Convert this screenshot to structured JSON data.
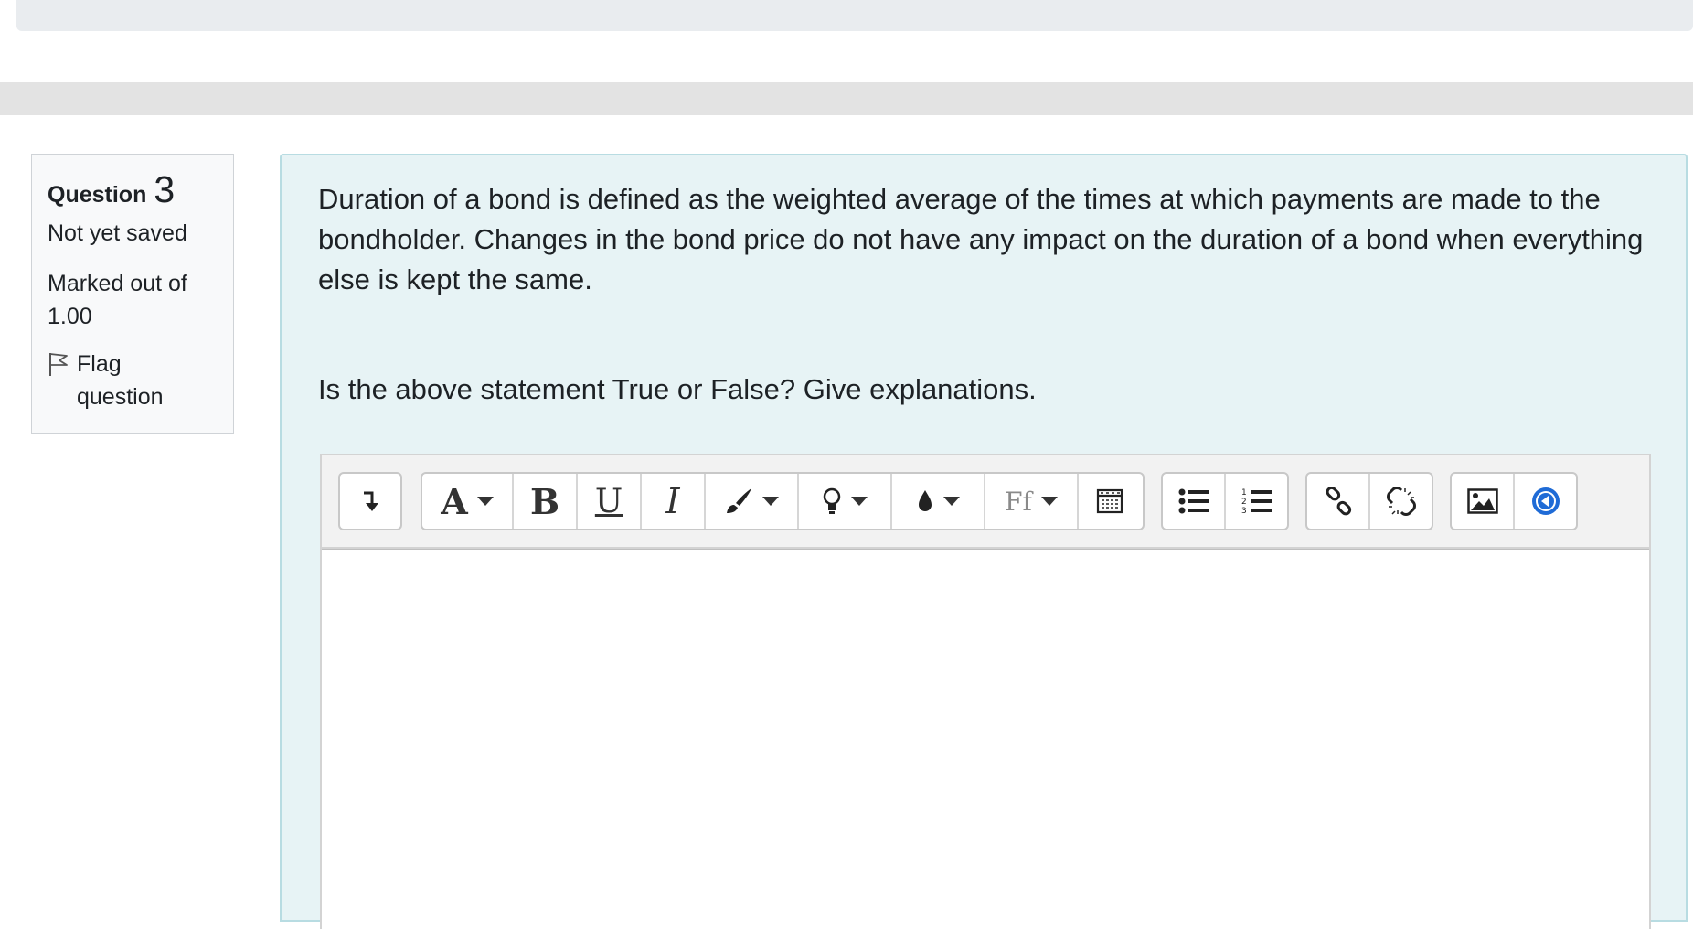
{
  "quiz_info": {
    "question_label": "Question",
    "question_number": "3",
    "state": "Not yet saved",
    "grade_line1": "Marked out of",
    "grade_line2": "1.00",
    "flag_label": "Flag question"
  },
  "question": {
    "text": "Duration of a bond is defined as the weighted average of the times at which payments are made to the bondholder. Changes in the bond price do not have any impact on the duration of a bond when everything else is kept the same.",
    "prompt": "Is the above statement True or False? Give explanations."
  },
  "editor": {
    "toolbar_icons": [
      "toolbar-toggle-icon",
      "font-style-icon",
      "bold-icon",
      "underline-icon",
      "italic-icon",
      "brush-icon",
      "lightbulb-icon",
      "color-drop-icon",
      "font-family-icon",
      "table-icon",
      "bullet-list-icon",
      "numbered-list-icon",
      "link-icon",
      "unlink-icon",
      "image-icon",
      "media-icon"
    ],
    "labels": {
      "font_style": "A",
      "bold": "B",
      "underline": "U",
      "italic": "I",
      "font_family": "Ff"
    },
    "answer_value": ""
  },
  "colors": {
    "content_bg": "#e7f3f5",
    "content_border": "#b8dce2",
    "info_bg": "#f8f9fa",
    "accent_blue": "#1f6bd6"
  }
}
